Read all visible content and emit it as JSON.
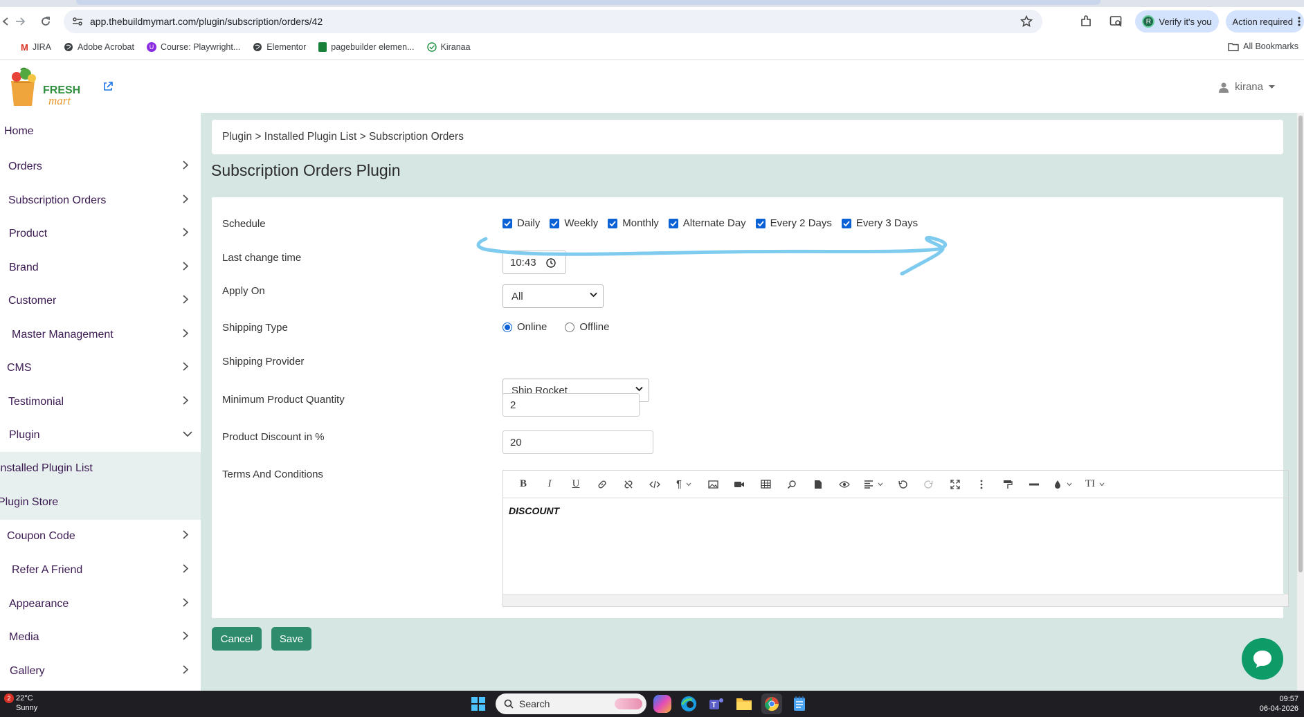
{
  "browser": {
    "url": "app.thebuildmymart.com/plugin/subscription/orders/42",
    "verify_label": "Verify it's you",
    "verify_avatar": "R",
    "action_label": "Action required",
    "bookmarks": [
      "JIRA",
      "Adobe Acrobat",
      "Course: Playwright...",
      "Elementor",
      "pagebuilder elemen...",
      "Kiranaa"
    ],
    "all_bookmarks": "All Bookmarks"
  },
  "header": {
    "logo_top": "FRESH",
    "logo_bottom": "mart",
    "user": "kirana"
  },
  "sidebar": {
    "items": [
      {
        "label": "Home"
      },
      {
        "label": "Orders"
      },
      {
        "label": "Subscription Orders"
      },
      {
        "label": "Product"
      },
      {
        "label": "Brand"
      },
      {
        "label": "Customer"
      },
      {
        "label": "Master Management"
      },
      {
        "label": "CMS"
      },
      {
        "label": "Testimonial"
      },
      {
        "label": "Plugin"
      },
      {
        "label": "Installed Plugin List"
      },
      {
        "label": "Plugin Store"
      },
      {
        "label": "Coupon Code"
      },
      {
        "label": "Refer A Friend"
      },
      {
        "label": "Appearance"
      },
      {
        "label": "Media"
      },
      {
        "label": "Gallery"
      }
    ]
  },
  "breadcrumb": "Plugin > Installed Plugin List > Subscription Orders",
  "page_title": "Subscription Orders Plugin",
  "form": {
    "schedule_label": "Schedule",
    "schedule_options": [
      "Daily",
      "Weekly",
      "Monthly",
      "Alternate Day",
      "Every 2 Days",
      "Every 3 Days"
    ],
    "last_change_label": "Last change time",
    "last_change_value": "10:43",
    "apply_on_label": "Apply On",
    "apply_on_value": "All",
    "shipping_type_label": "Shipping Type",
    "shipping_type_options": [
      "Online",
      "Offline"
    ],
    "shipping_type_selected": "Online",
    "shipping_provider_label": "Shipping Provider",
    "shipping_provider_value": "Ship Rocket",
    "min_qty_label": "Minimum Product Quantity",
    "min_qty_value": "2",
    "discount_label": "Product Discount in %",
    "discount_value": "20",
    "terms_label": "Terms And Conditions",
    "terms_text": "DISCOUNT"
  },
  "buttons": {
    "cancel": "Cancel",
    "save": "Save"
  },
  "taskbar": {
    "notifications": "2",
    "temperature": "22°C",
    "weather": "Sunny",
    "search_placeholder": "Search",
    "time": "09:57",
    "date": "06-04-2026"
  },
  "colors": {
    "accent": "#2e8b6b",
    "main_bg": "#d6e6e3",
    "checkbox": "#0b62d6",
    "annotation_stroke": "#7fcbef"
  }
}
